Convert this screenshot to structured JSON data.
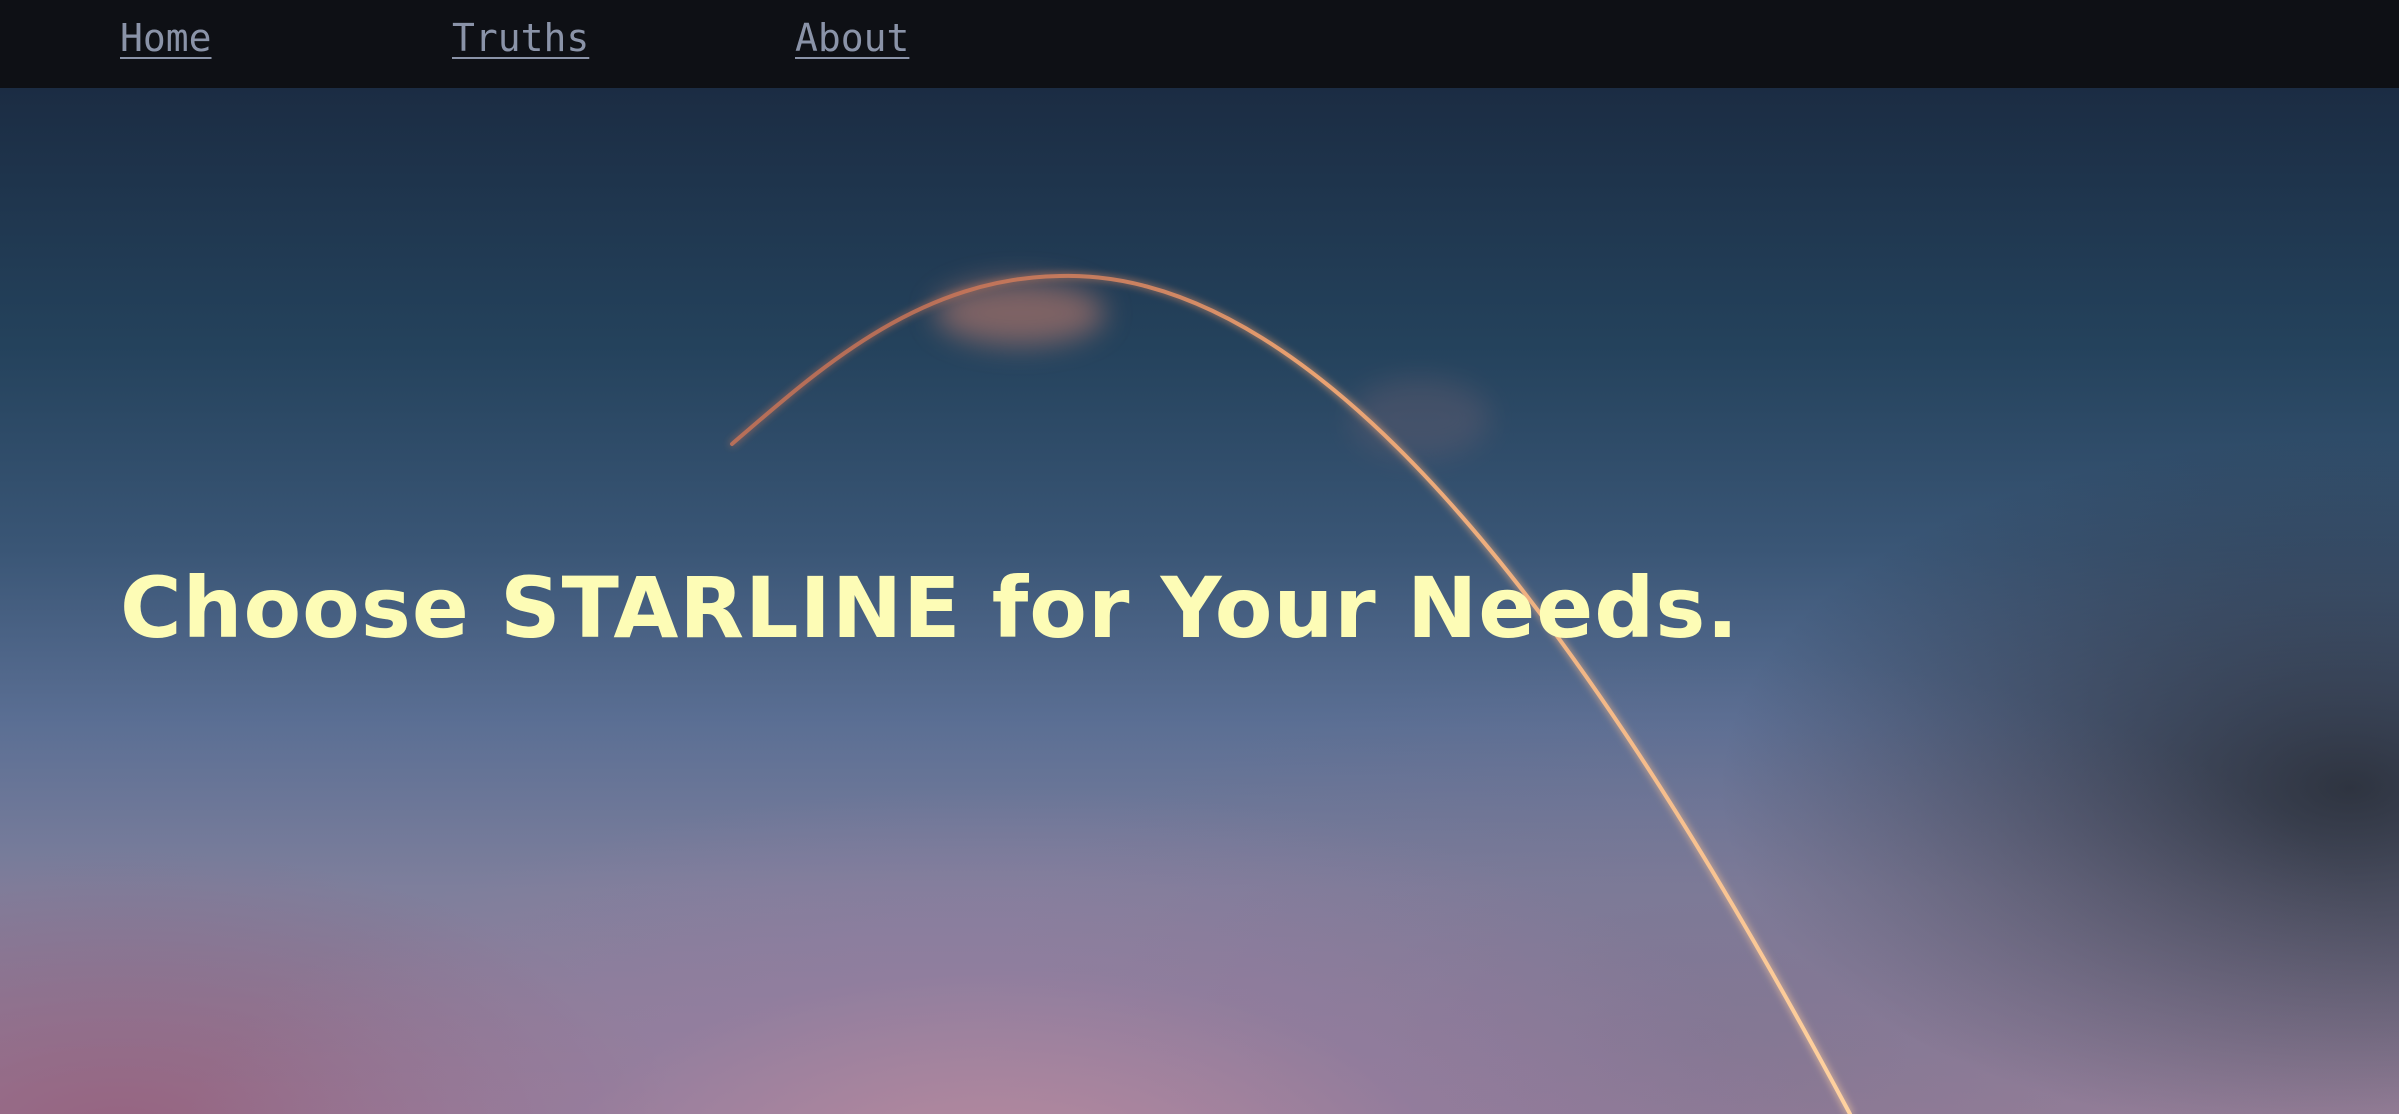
{
  "nav": {
    "items": [
      {
        "label": "Home"
      },
      {
        "label": "Truths"
      },
      {
        "label": "About"
      }
    ]
  },
  "hero": {
    "headline": "Choose STARLINE for Your Needs.",
    "background_image": "rocket-launch-trail-sky"
  },
  "colors": {
    "nav_background": "#0e1015",
    "nav_link": "#8a93a8",
    "headline": "#fdfcb6",
    "trail": "#f0b482"
  }
}
